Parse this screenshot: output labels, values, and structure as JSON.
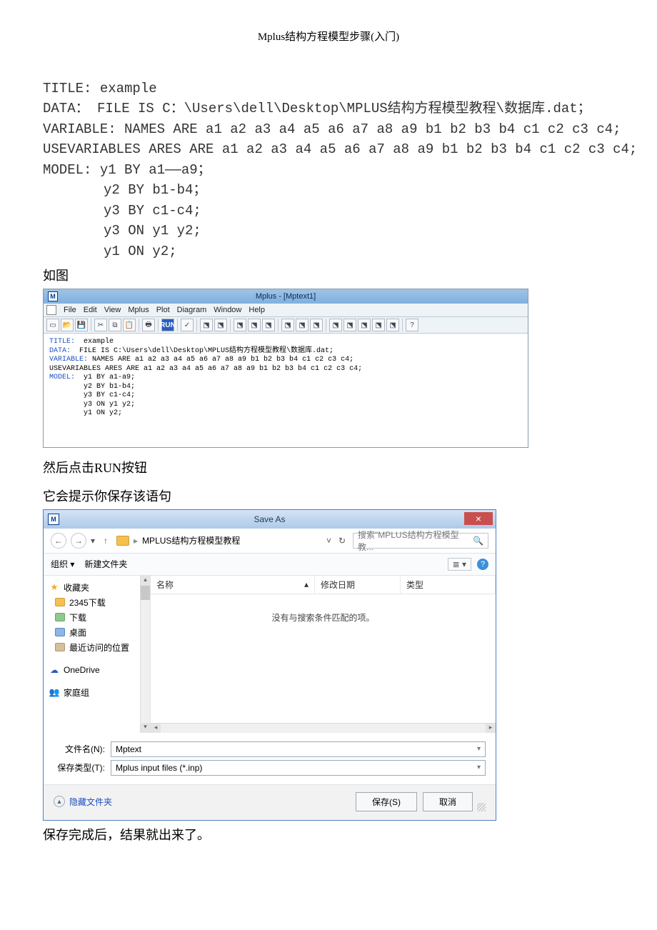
{
  "page_title": "Mplus结构方程模型步骤(入门)",
  "code": {
    "l1": "TITLE: example",
    "l2": "DATA： FILE IS C：\\Users\\dell\\Desktop\\MPLUS结构方程模型教程\\数据库.dat；",
    "l3": "VARIABLE: NAMES ARE a1 a2 a3 a4 a5 a6 a7 a8 a9 b1 b2 b3 b4 c1 c2 c3 c4;",
    "l4": "USEVARIABLES ARES ARE a1 a2 a3 a4 a5 a6 a7 a8 a9 b1 b2 b3 b4 c1 c2 c3 c4;",
    "l5": "MODEL: y1 BY a1——a9；",
    "i1": "y2 BY b1-b4；",
    "i2": "y3 BY c1-c4;",
    "i3": "y3 ON y1 y2;",
    "i4": "y1 ON y2;"
  },
  "caption_rutu": "如图",
  "mplus": {
    "logo": "M",
    "title": "Mplus - [Mptext1]",
    "menu": [
      "File",
      "Edit",
      "View",
      "Mplus",
      "Plot",
      "Diagram",
      "Window",
      "Help"
    ],
    "run_label": "RUN",
    "help_label": "?",
    "editor": {
      "kw_title": "TITLE:",
      "v_title": "  example",
      "kw_data": "DATA:",
      "v_data": "  FILE IS C:\\Users\\dell\\Desktop\\MPLUS结构方程模型教程\\数据库.dat;",
      "kw_var": "VARIABLE:",
      "v_var": " NAMES ARE a1 a2 a3 a4 a5 a6 a7 a8 a9 b1 b2 b3 b4 c1 c2 c3 c4;",
      "v_usevar": "USEVARIABLES ARES ARE a1 a2 a3 a4 a5 a6 a7 a8 a9 b1 b2 b3 b4 c1 c2 c3 c4;",
      "kw_model": "MODEL:",
      "v_model": "  y1 BY a1-a9;",
      "m1": "        y2 BY b1-b4;",
      "m2": "        y3 BY c1-c4;",
      "m3": "        y3 ON y1 y2;",
      "m4": "        y1 ON y2;"
    }
  },
  "caption_run": "然后点击RUN按钮",
  "caption_save": "它会提示你保存该语句",
  "saveas": {
    "logo": "M",
    "title": "Save As",
    "close": "×",
    "nav": {
      "back": "←",
      "fwd": "→",
      "dd": "▾",
      "up": "↑",
      "sep": "▸",
      "path": "MPLUS结构方程模型教程",
      "path_dd": "˅",
      "refresh": "↻",
      "search_placeholder": "搜索\"MPLUS结构方程模型教...",
      "search_icon": "🔍"
    },
    "toolbar": {
      "organize": "组织 ▾",
      "newfolder": "新建文件夹",
      "view": "≣ ▾",
      "help": "?"
    },
    "sidebar": {
      "fav": "收藏夹",
      "i2345": "2345下载",
      "dl": "下载",
      "desk": "桌面",
      "recent": "最近访问的位置",
      "onedrive": "OneDrive",
      "homegroup": "家庭组"
    },
    "columns": {
      "name": "名称",
      "date": "修改日期",
      "type": "类型",
      "sort": "▴"
    },
    "empty": "没有与搜索条件匹配的项。",
    "filename_label": "文件名(N):",
    "filename_value": "Mptext",
    "filetype_label": "保存类型(T):",
    "filetype_value": "Mplus input files (*.inp)",
    "hide_folders": "隐藏文件夹",
    "save_btn": "保存(S)",
    "cancel_btn": "取消"
  },
  "caption_done": "保存完成后，结果就出来了。"
}
